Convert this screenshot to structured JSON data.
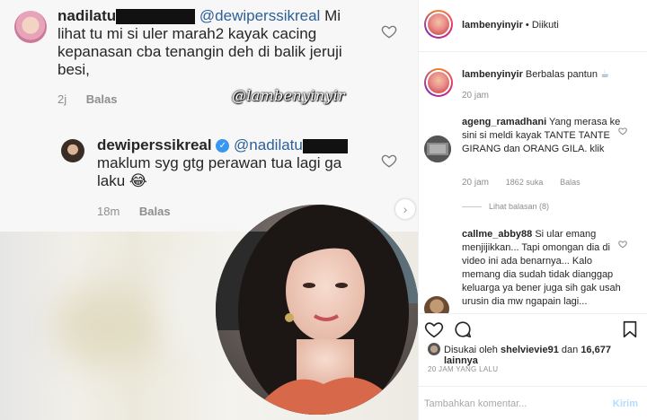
{
  "left": {
    "comment1": {
      "user": "nadilatu",
      "mention": "@dewiperssikreal",
      "text": "Mi lihat tu mi si uler marah2 kayak cacing kepanasan cba tenangin deh di balik jeruji besi,",
      "time": "2j",
      "reply": "Balas"
    },
    "watermark": "@lambenyinyir",
    "comment2": {
      "user": "dewiperssikreal",
      "mention": "@nadilatu",
      "text": "maklum syg gtg perawan tua lagi ga laku 😂",
      "time": "18m",
      "reply": "Balas"
    }
  },
  "header": {
    "username": "lambenyinyir",
    "separator": "•",
    "follow_status": "Diikuti"
  },
  "caption": {
    "username": "lambenyinyir",
    "text": "Berbalas pantun",
    "emoji": "☕",
    "time": "20 jam"
  },
  "comments": [
    {
      "username": "ageng_ramadhani",
      "text": "Yang merasa ke sini si meldi kayak TANTE TANTE GIRANG dan ORANG GILA. klik",
      "time": "20 jam",
      "likes": "1862 suka",
      "reply": "Balas",
      "view_replies": "Lihat balasan (8)"
    },
    {
      "username": "callme_abby88",
      "text": "Si ular emang menjijikkan... Tapi omongan dia di video ini ada benarnya... Kalo memang dia sudah tidak dianggap keluarga ya bener juga sih gak usah urusin dia mw ngapain lagi... Serahkan saja"
    }
  ],
  "actions": {
    "liked_prefix": "Disukai oleh",
    "liked_user": "shelvievie91",
    "liked_mid": "dan",
    "liked_count": "16,677 lainnya",
    "timestamp": "20 JAM YANG LALU",
    "comment_placeholder": "Tambahkan komentar...",
    "post_button": "Kirim"
  }
}
